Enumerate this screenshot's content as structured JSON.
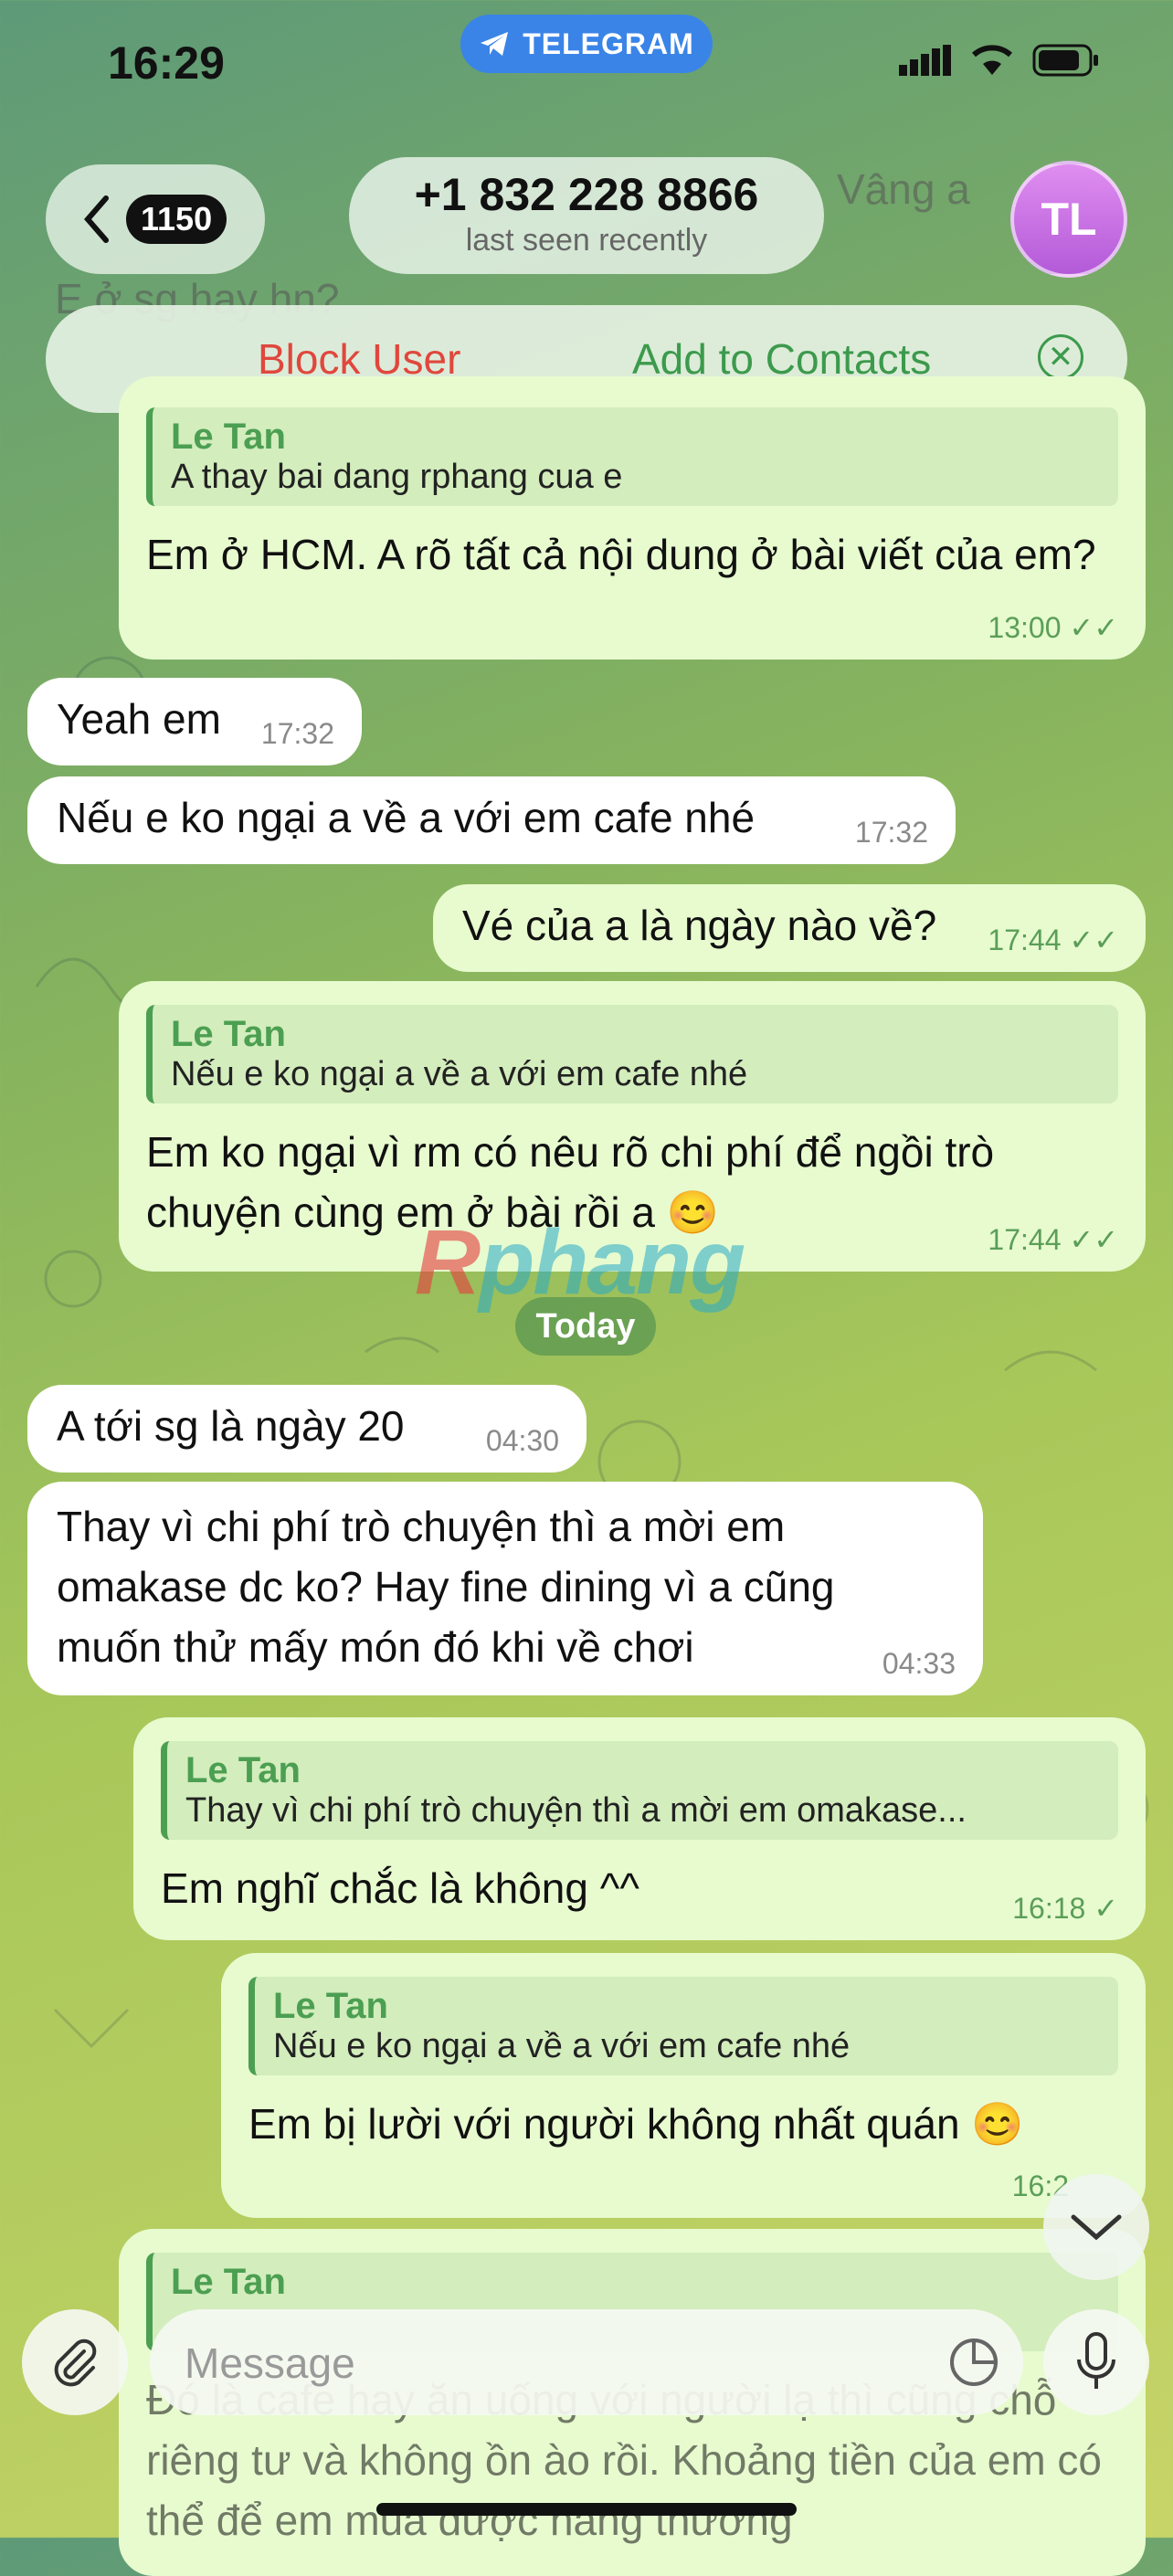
{
  "status_bar": {
    "time": "16:29",
    "telegram_label": "TELEGRAM"
  },
  "header": {
    "back_badge": "1150",
    "title": "+1 832 228 8866",
    "subtitle": "last seen recently",
    "avatar_initials": "TL",
    "peek_right": "Vâng a",
    "peek_left": "E ở sg hay hn?"
  },
  "action_bar": {
    "block_label": "Block User",
    "add_label": "Add to Contacts"
  },
  "messages": [
    {
      "reply_name": "Le Tan",
      "reply_text": "A thay bai dang rphang cua e",
      "text": "Em ở HCM. A rõ tất cả nội dung ở bài viết của em?",
      "time": "13:00"
    },
    {
      "text": "Yeah em",
      "time": "17:32"
    },
    {
      "text": "Nếu e ko ngại a về a với em cafe nhé",
      "time": "17:32"
    },
    {
      "text": "Vé của a là ngày nào về?",
      "time": "17:44"
    },
    {
      "reply_name": "Le Tan",
      "reply_text": "Nếu e ko ngại a về a với em cafe nhé",
      "text": "Em ko ngại vì rm có nêu rõ chi phí để ngồi trò chuyện cùng em ở bài rồi a 😊",
      "time": "17:44"
    },
    {
      "text": "A tới sg là ngày 20",
      "time": "04:30"
    },
    {
      "text": "Thay vì chi phí trò chuyện thì a mời em omakase dc ko? Hay fine dining vì a cũng muốn thử mấy món đó khi về chơi",
      "time": "04:33"
    },
    {
      "reply_name": "Le Tan",
      "reply_text": "Thay vì chi phí trò chuyện thì a mời em omakase...",
      "text": "Em nghĩ chắc là không ^^",
      "time": "16:18"
    },
    {
      "reply_name": "Le Tan",
      "reply_text": "Nếu e ko ngại a về a với em cafe nhé",
      "text": "Em bị lười với người không nhất quán 😊",
      "time": "16:2"
    },
    {
      "reply_name": "Le Tan",
      "text": "Đó là cafe hay ăn uống với người lạ thì cũng chỗ riêng tư và không ồn ào rồi. Khoảng tiền của em có thể để em mua được hàng thương"
    }
  ],
  "date_separator": "Today",
  "watermark": {
    "part1": "R",
    "part2": "phang"
  },
  "input": {
    "placeholder": "Message"
  }
}
